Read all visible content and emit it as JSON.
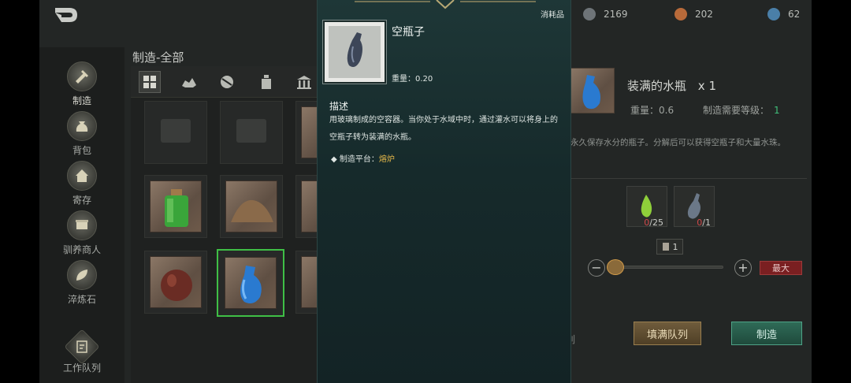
{
  "nav": {
    "items": [
      {
        "label": "制造"
      },
      {
        "label": "背包"
      },
      {
        "label": "寄存"
      },
      {
        "label": "驯养商人"
      },
      {
        "label": "淬炼石"
      },
      {
        "label": "工作队列"
      }
    ]
  },
  "page": {
    "title": "制造-全部"
  },
  "resources": [
    {
      "value": "2169",
      "color": "#6e7478"
    },
    {
      "value": "202",
      "color": "#b86a3a"
    },
    {
      "value": "62",
      "color": "#4a7fa8"
    }
  ],
  "recipe": {
    "name": "装满的水瓶",
    "quantity": "x 1",
    "weight": "重量：0.6",
    "level_label": "制造需要等级：",
    "level_value": "1",
    "description": "永久保存水分的瓶子。分解后可以获得空瓶子和大量水珠。",
    "materials": [
      {
        "have": "0",
        "need": "/25"
      },
      {
        "have": "0",
        "need": "/1"
      }
    ],
    "batch_count": "1",
    "max_label": "最大",
    "fill_queue_label": "填满队列",
    "craft_label": "制造",
    "view_queue_label": "查看队列"
  },
  "tooltip": {
    "category": "消耗品",
    "name": "空瓶子",
    "weight": "重量：0.20",
    "desc_heading": "描述",
    "description": "用玻璃制成的空容器。当你处于水域中时，通过灌水可以将身上的空瓶子转为装满的水瓶。",
    "platform_label": "制造平台：",
    "platform_value": "熔炉"
  },
  "colors": {
    "accent_green": "#3fbf46",
    "tooltip_bg": "#1a3031",
    "highlight_yellow": "#e5b84a",
    "level_green": "#3fbf7a",
    "danger_red": "#d0484a"
  }
}
